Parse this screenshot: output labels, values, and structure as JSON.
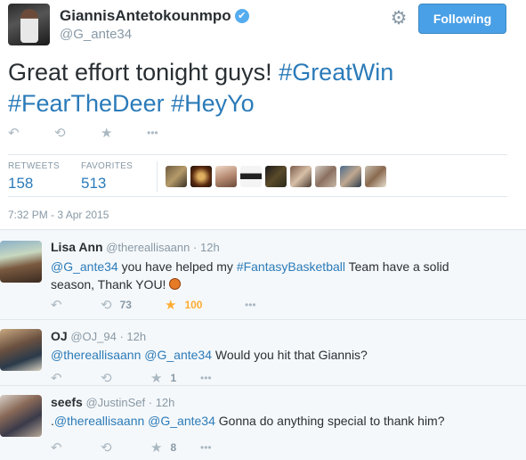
{
  "header": {
    "display_name": "GiannisAntetokounmpo",
    "verified_glyph": "✔",
    "handle": "@G_ante34",
    "follow_label": "Following",
    "settings_icon": "gear-icon"
  },
  "tweet": {
    "text_plain": "Great effort tonight guys! ",
    "hashtags": [
      "#GreatWin",
      "#FearTheDeer",
      "#HeyYo"
    ],
    "timestamp": "7:32 PM - 3 Apr 2015"
  },
  "stats": {
    "retweets_label": "RETWEETS",
    "retweets_value": "158",
    "favorites_label": "FAVORITES",
    "favorites_value": "513"
  },
  "icons": {
    "reply": "↶",
    "retweet": "⟲",
    "favorite": "★",
    "more": "•••"
  },
  "colors": {
    "link": "#2b7bb9",
    "follow_button": "#4aa0e6",
    "favorite_active": "#ffac33"
  },
  "replies": [
    {
      "name": "Lisa Ann",
      "handle": "@thereallisaann",
      "dot": "·",
      "time": "12h",
      "mention": "@G_ante34",
      "text_a": " you have helped my ",
      "hashtag": "#FantasyBasketball",
      "text_b": " Team have a solid season, Thank YOU!",
      "retweets": "73",
      "favorites": "100"
    },
    {
      "name": "OJ",
      "handle": "@OJ_94",
      "dot": "·",
      "time": "12h",
      "mention1": "@thereallisaann",
      "mention2": "@G_ante34",
      "text": " Would you hit that Giannis?",
      "favorites": "1"
    },
    {
      "name": "seefs",
      "handle": "@JustinSef",
      "dot": "·",
      "time": "12h",
      "prefix": ".",
      "mention1": "@thereallisaann",
      "mention2": "@G_ante34",
      "text": " Gonna do anything special to thank him?",
      "favorites": "8"
    }
  ]
}
